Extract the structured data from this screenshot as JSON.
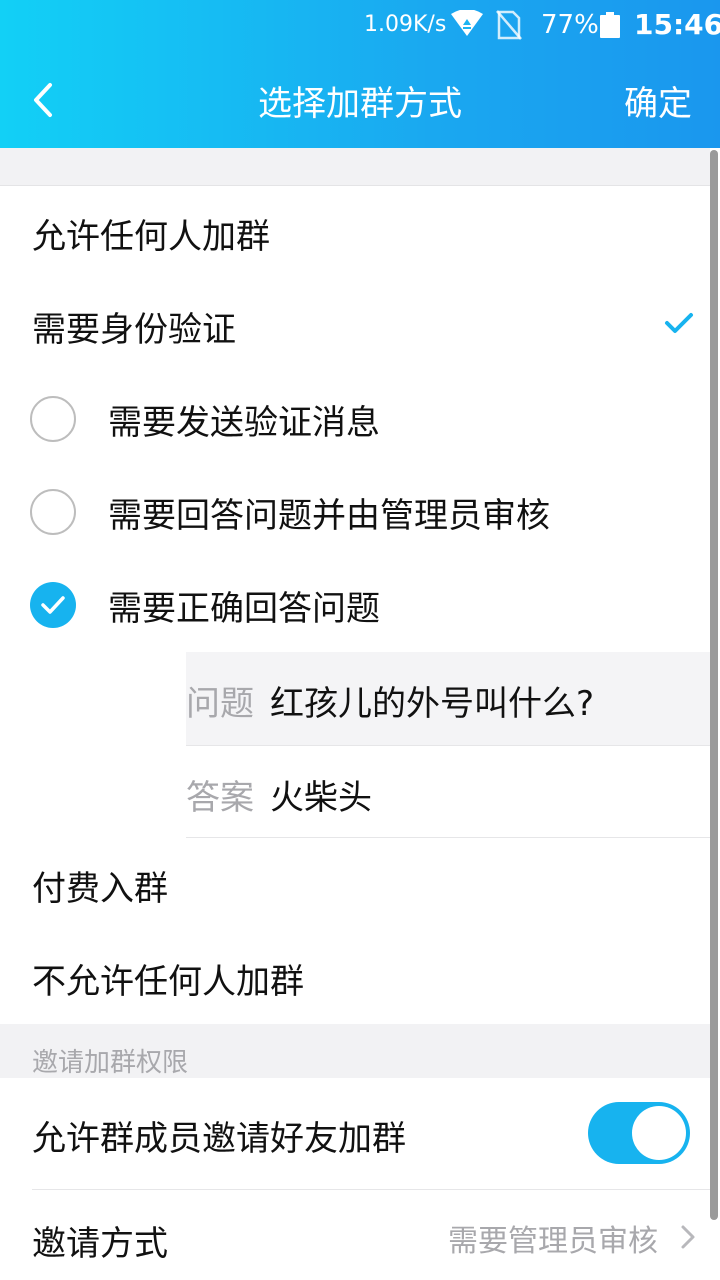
{
  "status_bar": {
    "network_speed": "1.09K/s",
    "battery_percent": "77%",
    "time": "15:46",
    "icons": [
      "wifi-icon",
      "no-sim-icon",
      "battery-icon"
    ]
  },
  "nav": {
    "title": "选择加群方式",
    "confirm_label": "确定",
    "back_icon": "chevron-left-icon"
  },
  "join_options": {
    "allow_anyone": "允许任何人加群",
    "need_verify": "需要身份验证",
    "need_verify_selected": true,
    "sub_options": [
      {
        "label": "需要发送验证消息",
        "selected": false
      },
      {
        "label": "需要回答问题并由管理员审核",
        "selected": false
      },
      {
        "label": "需要正确回答问题",
        "selected": true
      }
    ],
    "question_key": "问题",
    "question_value": "红孩儿的外号叫什么?",
    "answer_key": "答案",
    "answer_value": "火柴头",
    "paid": "付费入群",
    "disallow": "不允许任何人加群"
  },
  "invite_section": {
    "header": "邀请加群权限",
    "allow_members_invite": "允许群成员邀请好友加群",
    "allow_members_invite_on": true,
    "invite_method_label": "邀请方式",
    "invite_method_value": "需要管理员审核"
  },
  "colors": {
    "accent": "#17b3ef",
    "header_start": "#12d0f6",
    "header_end": "#1a97ee",
    "secondary_text": "#a8a8ac",
    "section_bg": "#f2f2f4"
  }
}
